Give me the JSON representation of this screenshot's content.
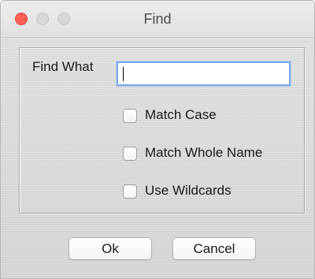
{
  "window": {
    "title": "Find"
  },
  "form": {
    "find_label": "Find What",
    "find_value": ""
  },
  "options": [
    {
      "label": "Match Case",
      "checked": false
    },
    {
      "label": "Match Whole Name",
      "checked": false
    },
    {
      "label": "Use Wildcards",
      "checked": false
    }
  ],
  "buttons": {
    "ok": "Ok",
    "cancel": "Cancel"
  }
}
